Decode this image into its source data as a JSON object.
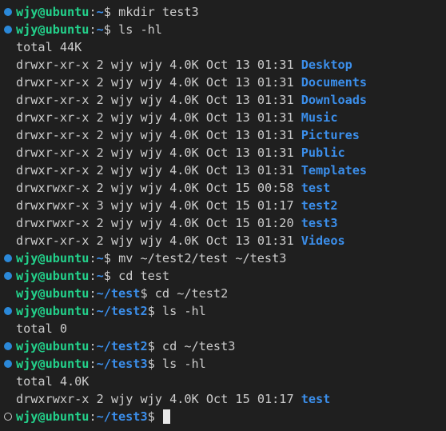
{
  "terminal": {
    "user_host": "wjy@ubuntu",
    "lines": [
      {
        "kind": "prompt",
        "marker": "done",
        "path": "~",
        "command": "mkdir test3"
      },
      {
        "kind": "prompt",
        "marker": "done",
        "path": "~",
        "command": "ls -hl"
      },
      {
        "kind": "output",
        "text": "total 44K"
      },
      {
        "kind": "entry",
        "perms": "drwxr-xr-x",
        "links": "2",
        "owner": "wjy",
        "group": "wjy",
        "size": "4.0K",
        "month": "Oct",
        "day": "13",
        "time": "01:31",
        "name": "Desktop"
      },
      {
        "kind": "entry",
        "perms": "drwxr-xr-x",
        "links": "2",
        "owner": "wjy",
        "group": "wjy",
        "size": "4.0K",
        "month": "Oct",
        "day": "13",
        "time": "01:31",
        "name": "Documents"
      },
      {
        "kind": "entry",
        "perms": "drwxr-xr-x",
        "links": "2",
        "owner": "wjy",
        "group": "wjy",
        "size": "4.0K",
        "month": "Oct",
        "day": "13",
        "time": "01:31",
        "name": "Downloads"
      },
      {
        "kind": "entry",
        "perms": "drwxr-xr-x",
        "links": "2",
        "owner": "wjy",
        "group": "wjy",
        "size": "4.0K",
        "month": "Oct",
        "day": "13",
        "time": "01:31",
        "name": "Music"
      },
      {
        "kind": "entry",
        "perms": "drwxr-xr-x",
        "links": "2",
        "owner": "wjy",
        "group": "wjy",
        "size": "4.0K",
        "month": "Oct",
        "day": "13",
        "time": "01:31",
        "name": "Pictures"
      },
      {
        "kind": "entry",
        "perms": "drwxr-xr-x",
        "links": "2",
        "owner": "wjy",
        "group": "wjy",
        "size": "4.0K",
        "month": "Oct",
        "day": "13",
        "time": "01:31",
        "name": "Public"
      },
      {
        "kind": "entry",
        "perms": "drwxr-xr-x",
        "links": "2",
        "owner": "wjy",
        "group": "wjy",
        "size": "4.0K",
        "month": "Oct",
        "day": "13",
        "time": "01:31",
        "name": "Templates"
      },
      {
        "kind": "entry",
        "perms": "drwxrwxr-x",
        "links": "2",
        "owner": "wjy",
        "group": "wjy",
        "size": "4.0K",
        "month": "Oct",
        "day": "15",
        "time": "00:58",
        "name": "test"
      },
      {
        "kind": "entry",
        "perms": "drwxrwxr-x",
        "links": "3",
        "owner": "wjy",
        "group": "wjy",
        "size": "4.0K",
        "month": "Oct",
        "day": "15",
        "time": "01:17",
        "name": "test2"
      },
      {
        "kind": "entry",
        "perms": "drwxrwxr-x",
        "links": "2",
        "owner": "wjy",
        "group": "wjy",
        "size": "4.0K",
        "month": "Oct",
        "day": "15",
        "time": "01:20",
        "name": "test3"
      },
      {
        "kind": "entry",
        "perms": "drwxr-xr-x",
        "links": "2",
        "owner": "wjy",
        "group": "wjy",
        "size": "4.0K",
        "month": "Oct",
        "day": "13",
        "time": "01:31",
        "name": "Videos"
      },
      {
        "kind": "prompt",
        "marker": "done",
        "path": "~",
        "command": "mv ~/test2/test ~/test3"
      },
      {
        "kind": "prompt",
        "marker": "done",
        "path": "~",
        "command": "cd test"
      },
      {
        "kind": "prompt",
        "marker": "none",
        "path": "~/test",
        "command": "cd ~/test2"
      },
      {
        "kind": "prompt",
        "marker": "done",
        "path": "~/test2",
        "command": "ls -hl"
      },
      {
        "kind": "output",
        "text": "total 0"
      },
      {
        "kind": "prompt",
        "marker": "done",
        "path": "~/test2",
        "command": "cd ~/test3"
      },
      {
        "kind": "prompt",
        "marker": "done",
        "path": "~/test3",
        "command": "ls -hl"
      },
      {
        "kind": "output",
        "text": "total 4.0K"
      },
      {
        "kind": "entry",
        "perms": "drwxrwxr-x",
        "links": "2",
        "owner": "wjy",
        "group": "wjy",
        "size": "4.0K",
        "month": "Oct",
        "day": "15",
        "time": "01:17",
        "name": "test"
      },
      {
        "kind": "prompt",
        "marker": "pending",
        "path": "~/test3",
        "command": "",
        "cursor": true
      }
    ]
  },
  "colors": {
    "background": "#1f1f1f",
    "foreground": "#cccccc",
    "user_green": "#23d18b",
    "path_blue": "#3b8eea",
    "marker_blue": "#2b88d8"
  }
}
